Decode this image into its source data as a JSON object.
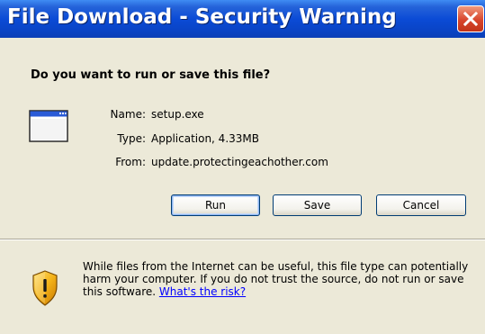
{
  "window": {
    "title": "File Download - Security Warning",
    "close_icon": "close-icon"
  },
  "prompt": {
    "question": "Do you want to run or save this file?"
  },
  "file": {
    "icon": "application-window-icon",
    "name_label": "Name:",
    "name_value": "setup.exe",
    "type_label": "Type:",
    "type_value": "Application, 4.33MB",
    "from_label": "From:",
    "from_value": "update.protectingeachother.com"
  },
  "buttons": {
    "run": "Run",
    "save": "Save",
    "cancel": "Cancel"
  },
  "warning": {
    "icon": "security-shield-icon",
    "text": "While files from the Internet can be useful, this file type can potentially harm your computer. If you do not trust the source, do not run or save this software. ",
    "link": "What's the risk?"
  },
  "colors": {
    "title_bar": "#0a44c6",
    "dialog_bg": "#ece9d8",
    "close_button": "#d8452c",
    "link": "#0000ff"
  }
}
